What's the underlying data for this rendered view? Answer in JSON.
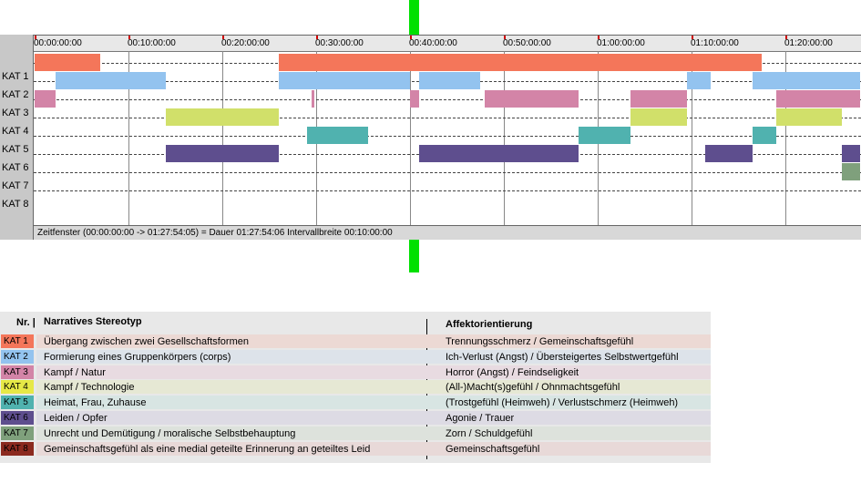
{
  "timeline": {
    "ruler_ticks": [
      "00:00:00:00",
      "00:10:00:00",
      "00:20:00:00",
      "00:30:00:00",
      "00:40:00:00",
      "00:50:00:00",
      "01:00:00:00",
      "01:10:00:00",
      "01:20:00:00"
    ],
    "total_minutes": 88,
    "rows": [
      {
        "label": "KAT 1",
        "color": "#f4765a",
        "segments": [
          [
            0,
            7
          ],
          [
            26,
            77.5
          ]
        ]
      },
      {
        "label": "KAT 2",
        "color": "#93c3ef",
        "segments": [
          [
            2.2,
            14
          ],
          [
            26,
            40
          ],
          [
            41,
            47.5
          ],
          [
            69.5,
            72
          ],
          [
            76.5,
            88
          ]
        ]
      },
      {
        "label": "KAT 3",
        "color": "#d384a7",
        "segments": [
          [
            0,
            2.2
          ],
          [
            29.5,
            29.6
          ],
          [
            40,
            41
          ],
          [
            48,
            58
          ],
          [
            63.5,
            69.5
          ],
          [
            79,
            88
          ]
        ]
      },
      {
        "label": "KAT 4",
        "color": "#d1e06a",
        "segments": [
          [
            14,
            26
          ],
          [
            63.5,
            69.5
          ],
          [
            79,
            86
          ]
        ]
      },
      {
        "label": "KAT 5",
        "color": "#50b2af",
        "segments": [
          [
            29,
            35.5
          ],
          [
            58,
            63.5
          ],
          [
            76.5,
            79
          ]
        ]
      },
      {
        "label": "KAT 6",
        "color": "#5e4e8e",
        "segments": [
          [
            14,
            26
          ],
          [
            41,
            58
          ],
          [
            71.5,
            76.5
          ],
          [
            86,
            88
          ]
        ]
      },
      {
        "label": "KAT 7",
        "color": "#7fa07c",
        "segments": [
          [
            86,
            88
          ]
        ]
      },
      {
        "label": "KAT 8",
        "color": "#8b2a1f",
        "segments": []
      }
    ],
    "status_text": "Zeitfenster (00:00:00:00 -> 01:27:54:05) = Dauer 01:27:54:06    Intervallbreite 00:10:00:00"
  },
  "legend": {
    "header_nr": "Nr. |",
    "header_desc": "Narratives Stereotyp",
    "header_aff": "Affektorientierung",
    "rows": [
      {
        "nr": "KAT 1",
        "color": "#f4765a",
        "bg": "#ecd9d4",
        "desc": "Übergang zwischen zwei Gesellschaftsformen",
        "aff": "Trennungsschmerz / Gemeinschaftsgefühl"
      },
      {
        "nr": "KAT 2",
        "color": "#93c3ef",
        "bg": "#dde3ea",
        "desc": "Formierung eines Gruppenkörpers (corps)",
        "aff": "Ich-Verlust (Angst) / Übersteigertes Selbstwertgefühl"
      },
      {
        "nr": "KAT 3",
        "color": "#d384a7",
        "bg": "#e8dbe1",
        "desc": "Kampf / Natur",
        "aff": "Horror (Angst) / Feindseligkeit"
      },
      {
        "nr": "KAT 4",
        "color": "#e6e846",
        "bg": "#e6e8d4",
        "desc": "Kampf / Technologie",
        "aff": "(All-)Macht(s)gefühl / Ohnmachtsgefühl"
      },
      {
        "nr": "KAT 5",
        "color": "#50b2af",
        "bg": "#d8e5e3",
        "desc": "Heimat, Frau, Zuhause",
        "aff": "(Trostgefühl (Heimweh) / Verlustschmerz (Heimweh)"
      },
      {
        "nr": "KAT 6",
        "color": "#5e4e8e",
        "bg": "#dddbe4",
        "desc": "Leiden / Opfer",
        "aff": "Agonie / Trauer"
      },
      {
        "nr": "KAT 7",
        "color": "#7fa07c",
        "bg": "#dde2dc",
        "desc": "Unrecht und Demütigung / moralische Selbstbehauptung",
        "aff": "Zorn / Schuldgefühl"
      },
      {
        "nr": "KAT 8",
        "color": "#8b2a1f",
        "bg": "#e8d9d8",
        "desc": "Gemeinschaftsgefühl als eine medial geteilte Erinnerung an geteiltes Leid",
        "aff": "Gemeinschaftsgefühl"
      }
    ]
  }
}
